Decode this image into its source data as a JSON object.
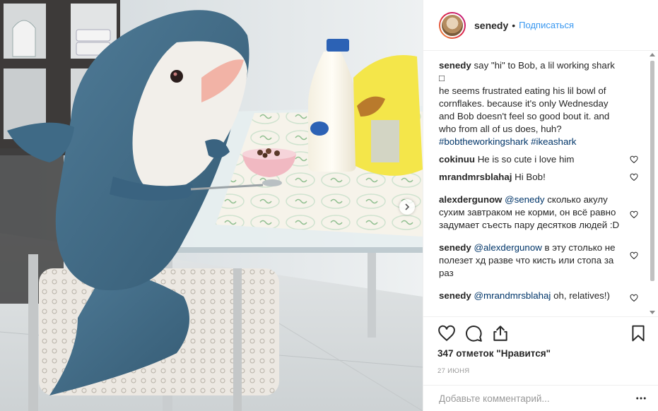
{
  "header": {
    "username": "senedy",
    "separator": "•",
    "follow_label": "Подписаться"
  },
  "caption": {
    "username": "senedy",
    "text_1": "say \"hi\" to Bob, a lil working shark",
    "text_2": "he seems frustrated eating his lil bowl of cornflakes. because it's only Wednesday and Bob doesn't feel so good bout it. and who from all of us does, huh?",
    "hashtag_1": "#bobtheworkingshark",
    "hashtag_2": "#ikeashark"
  },
  "comments": [
    {
      "username": "cokinuu",
      "text": "He is so cute i love him"
    },
    {
      "username": "mrandmrsblahaj",
      "text": "Hi Bob!"
    },
    {
      "username": "alexdergunow",
      "mention": "@senedy",
      "text": "сколько акулу сухим завтраком не корми, он всё равно задумает съесть пару десятков людей :D"
    },
    {
      "username": "senedy",
      "mention": "@alexdergunow",
      "text": "в эту столько не полезет хд разве что кисть или стопа за раз"
    },
    {
      "username": "senedy",
      "mention": "@mrandmrsblahaj",
      "text": "oh, relatives!)"
    }
  ],
  "likes": "347 отметок \"Нравится\"",
  "date": "27 ИЮНЯ",
  "add_comment": {
    "placeholder": "Добавьте комментарий..."
  },
  "icons": [
    "heart-icon",
    "comment-icon",
    "share-icon",
    "bookmark-icon",
    "more-icon",
    "chevron-right-icon"
  ],
  "colors": {
    "link": "#3897f0",
    "hashtag": "#003569",
    "text": "#262626",
    "muted": "#999999"
  }
}
